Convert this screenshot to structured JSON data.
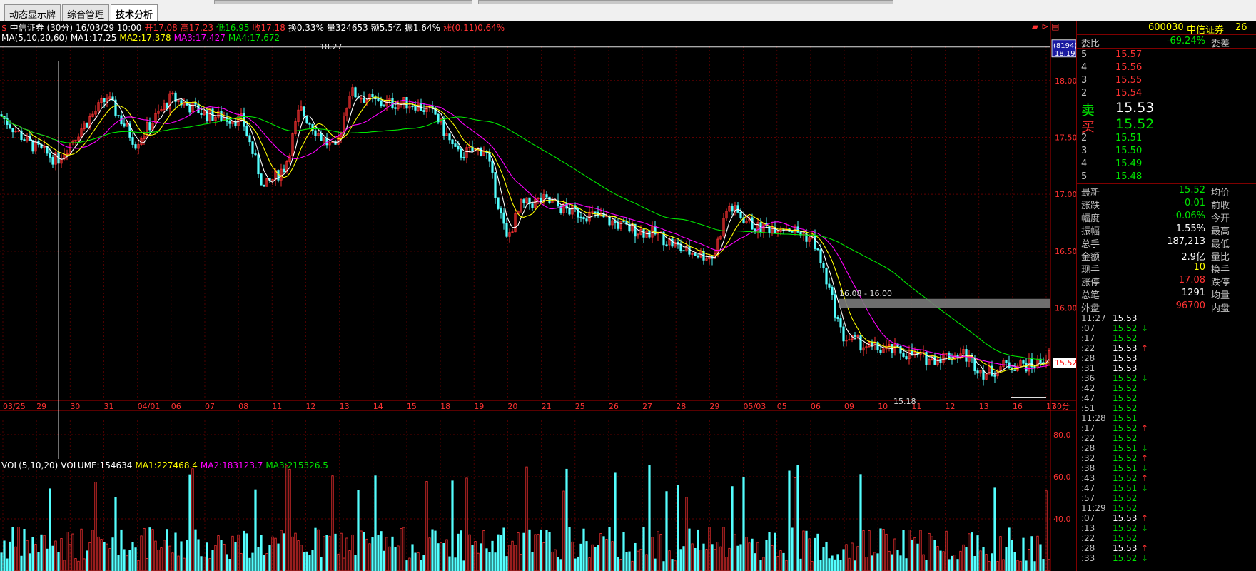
{
  "tabs": [
    "动态显示牌",
    "综合管理",
    "技术分析"
  ],
  "header": {
    "name": "中信证券 (30分)",
    "datetime": "16/03/29 10:00",
    "open": "开17.08",
    "high": "高17.23",
    "low": "低16.95",
    "close": "收17.18",
    "turnover": "换0.33%",
    "volume": "量324653",
    "amount": "额5.5亿",
    "amplitude": "振1.64%",
    "change": "涨(0.11)0.64%",
    "ma_label": "MA(5,10,20,60)",
    "ma1": "MA1:17.25",
    "ma2": "MA2:17.378",
    "ma3": "MA3:17.427",
    "ma4": "MA4:17.672"
  },
  "vol_header": {
    "label": "VOL(5,10,20)",
    "volume": "VOLUME:154634",
    "ma1": "MA1:227468.4",
    "ma2": "MA2:183123.7",
    "ma3": "MA3:215326.5"
  },
  "annotations": {
    "high_mark": "18.27",
    "low_mark": "15.18",
    "box_label": "16.08 - 16.00",
    "price_tag": "15.52",
    "badge_top": "(8194)",
    "badge_price": "18.19",
    "period": "30分"
  },
  "chart_data": {
    "type": "candlestick",
    "ylim": [
      15.2,
      18.3
    ],
    "y_ticks": [
      "18.00",
      "17.50",
      "17.00",
      "16.50",
      "16.00"
    ],
    "x_dates": [
      "03/25",
      "29",
      "30",
      "31",
      "04/01",
      "06",
      "07",
      "08",
      "11",
      "12",
      "13",
      "14",
      "15",
      "18",
      "19",
      "20",
      "21",
      "25",
      "26",
      "27",
      "28",
      "29",
      "05/03",
      "05",
      "06",
      "09",
      "10",
      "11",
      "12",
      "13",
      "16",
      "17"
    ],
    "vol_ticks": [
      "80.0",
      "60.0",
      "40.0"
    ],
    "series": [
      {
        "name": "MA1",
        "color": "#ffffff"
      },
      {
        "name": "MA2",
        "color": "#ffff00"
      },
      {
        "name": "MA3",
        "color": "#ff00ff"
      },
      {
        "name": "MA4",
        "color": "#00e600"
      }
    ]
  },
  "quote": {
    "code": "600030",
    "name": "中信证券",
    "num": "26",
    "weibi_label": "委比",
    "weibi_val": "-69.24%",
    "weicha_label": "委差",
    "sell_label": "卖",
    "buy_label": "买",
    "asks": [
      {
        "level": "5",
        "price": "15.57"
      },
      {
        "level": "4",
        "price": "15.56"
      },
      {
        "level": "3",
        "price": "15.55"
      },
      {
        "level": "2",
        "price": "15.54"
      }
    ],
    "ask1": "15.53",
    "bid1": "15.52",
    "bids": [
      {
        "level": "2",
        "price": "15.51"
      },
      {
        "level": "3",
        "price": "15.50"
      },
      {
        "level": "4",
        "price": "15.49"
      },
      {
        "level": "5",
        "price": "15.48"
      }
    ],
    "stats": [
      {
        "label": "最新",
        "value": "15.52",
        "color": "green",
        "right": "均价"
      },
      {
        "label": "涨跌",
        "value": "-0.01",
        "color": "green",
        "right": "前收"
      },
      {
        "label": "幅度",
        "value": "-0.06%",
        "color": "green",
        "right": "今开"
      },
      {
        "label": "振幅",
        "value": "1.55%",
        "color": "white",
        "right": "最高"
      },
      {
        "label": "总手",
        "value": "187,213",
        "color": "white",
        "right": "最低"
      },
      {
        "label": "金额",
        "value": "2.9亿",
        "color": "white",
        "right": "量比"
      },
      {
        "label": "现手",
        "value": "10",
        "color": "yellow",
        "right": "换手"
      },
      {
        "label": "涨停",
        "value": "17.08",
        "color": "red",
        "right": "跌停"
      },
      {
        "label": "总笔",
        "value": "1291",
        "color": "white",
        "right": "均量"
      },
      {
        "label": "外盘",
        "value": "96700",
        "color": "red",
        "right": "内盘"
      }
    ],
    "ticks": [
      {
        "time": "11:27",
        "price": "15.53",
        "pc": "white",
        "arrow": "",
        "ac": ""
      },
      {
        "time": ":07",
        "price": "15.52",
        "pc": "green",
        "arrow": "↓",
        "ac": "green"
      },
      {
        "time": ":17",
        "price": "15.52",
        "pc": "green",
        "arrow": "",
        "ac": ""
      },
      {
        "time": ":22",
        "price": "15.53",
        "pc": "white",
        "arrow": "↑",
        "ac": "red"
      },
      {
        "time": ":28",
        "price": "15.53",
        "pc": "white",
        "arrow": "",
        "ac": ""
      },
      {
        "time": ":31",
        "price": "15.53",
        "pc": "white",
        "arrow": "",
        "ac": ""
      },
      {
        "time": ":36",
        "price": "15.52",
        "pc": "green",
        "arrow": "↓",
        "ac": "green"
      },
      {
        "time": ":42",
        "price": "15.52",
        "pc": "green",
        "arrow": "",
        "ac": ""
      },
      {
        "time": ":47",
        "price": "15.52",
        "pc": "green",
        "arrow": "",
        "ac": ""
      },
      {
        "time": ":51",
        "price": "15.52",
        "pc": "green",
        "arrow": "",
        "ac": ""
      },
      {
        "time": "11:28",
        "price": "15.51",
        "pc": "green",
        "arrow": "",
        "ac": ""
      },
      {
        "time": ":17",
        "price": "15.52",
        "pc": "green",
        "arrow": "↑",
        "ac": "red"
      },
      {
        "time": ":22",
        "price": "15.52",
        "pc": "green",
        "arrow": "",
        "ac": ""
      },
      {
        "time": ":28",
        "price": "15.51",
        "pc": "green",
        "arrow": "↓",
        "ac": "green"
      },
      {
        "time": ":32",
        "price": "15.52",
        "pc": "green",
        "arrow": "↑",
        "ac": "red"
      },
      {
        "time": ":38",
        "price": "15.51",
        "pc": "green",
        "arrow": "↓",
        "ac": "green"
      },
      {
        "time": ":43",
        "price": "15.52",
        "pc": "green",
        "arrow": "↑",
        "ac": "red"
      },
      {
        "time": ":47",
        "price": "15.51",
        "pc": "green",
        "arrow": "↓",
        "ac": "green"
      },
      {
        "time": ":57",
        "price": "15.52",
        "pc": "green",
        "arrow": "",
        "ac": ""
      },
      {
        "time": "11:29",
        "price": "15.52",
        "pc": "green",
        "arrow": "",
        "ac": ""
      },
      {
        "time": ":07",
        "price": "15.53",
        "pc": "white",
        "arrow": "↑",
        "ac": "red"
      },
      {
        "time": ":13",
        "price": "15.52",
        "pc": "green",
        "arrow": "↓",
        "ac": "green"
      },
      {
        "time": ":22",
        "price": "15.52",
        "pc": "green",
        "arrow": "",
        "ac": ""
      },
      {
        "time": ":28",
        "price": "15.53",
        "pc": "white",
        "arrow": "↑",
        "ac": "red"
      },
      {
        "time": ":33",
        "price": "15.52",
        "pc": "green",
        "arrow": "↓",
        "ac": "green"
      }
    ]
  }
}
